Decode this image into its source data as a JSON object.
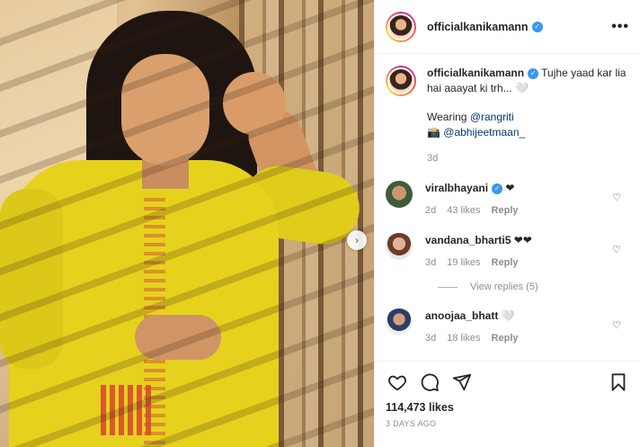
{
  "post": {
    "username": "officialkanikamann",
    "more_label": "•••",
    "caption": {
      "username": "officialkanikamann",
      "text": "Tujhe yaad kar lia hai aaayat ki trh... ",
      "emoji": "🤍",
      "wearing_label": "Wearing ",
      "tag1": "@rangriti",
      "tag2_prefix": "📸 ",
      "tag2": "@abhijeetmaan_",
      "time": "3d"
    },
    "comments": [
      {
        "username": "viralbhayani",
        "verified": true,
        "text": "❤",
        "time": "2d",
        "likes": "43 likes",
        "reply": "Reply"
      },
      {
        "username": "vandana_bharti5",
        "verified": false,
        "text": "❤❤",
        "time": "3d",
        "likes": "19 likes",
        "reply": "Reply",
        "view_replies": "View replies (5)"
      },
      {
        "username": "anoojaa_bhatt",
        "verified": false,
        "text": "🤍",
        "time": "3d",
        "likes": "18 likes",
        "reply": "Reply"
      }
    ],
    "like_count": "114,473 likes",
    "date": "3 DAYS AGO"
  },
  "icons": {
    "verified": "check-badge",
    "next": "chevron-right",
    "like": "heart-outline",
    "comment": "speech-bubble",
    "share": "paper-plane",
    "save": "bookmark"
  },
  "colors": {
    "verified": "#3897f0",
    "link": "#00376b",
    "muted": "#8e8e8e"
  }
}
